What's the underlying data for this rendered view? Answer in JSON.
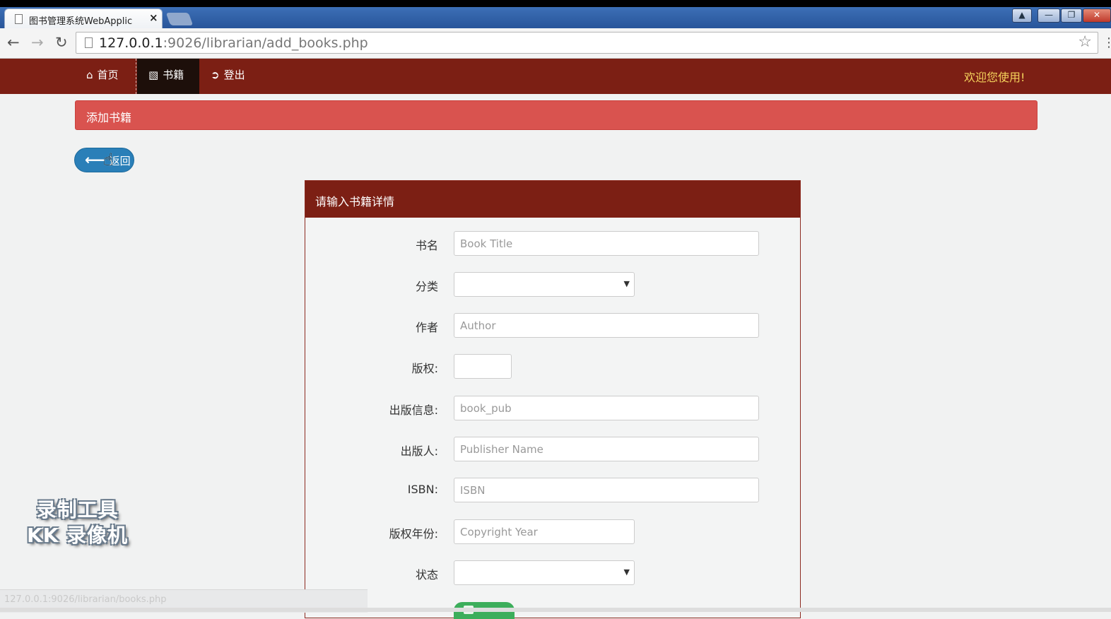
{
  "browser": {
    "tab_title": "图书管理系统WebApplic",
    "tab_close": "×",
    "url_host": "127.0.0.1",
    "url_rest": ":9026/librarian/add_books.php",
    "status_url": "127.0.0.1:9026/librarian/books.php"
  },
  "navbar": {
    "items": [
      {
        "label": "首页",
        "icon": "home-icon",
        "active": false
      },
      {
        "label": "书籍",
        "icon": "book-icon",
        "active": true
      },
      {
        "label": "登出",
        "icon": "sign-out-icon",
        "active": false
      }
    ],
    "welcome": "欢迎您使用!"
  },
  "page": {
    "header": "添加书籍",
    "back_label": "返回"
  },
  "form": {
    "heading": "请输入书籍详情",
    "fields": [
      {
        "label": "书名",
        "type": "text",
        "placeholder": "Book Title"
      },
      {
        "label": "分类",
        "type": "select",
        "value": ""
      },
      {
        "label": "作者",
        "type": "text",
        "placeholder": "Author"
      },
      {
        "label": "版权:",
        "type": "text",
        "placeholder": ""
      },
      {
        "label": "出版信息:",
        "type": "text",
        "placeholder": "book_pub"
      },
      {
        "label": "出版人:",
        "type": "text",
        "placeholder": "Publisher Name"
      },
      {
        "label": "ISBN:",
        "type": "text",
        "placeholder": "ISBN"
      },
      {
        "label": "版权年份:",
        "type": "text",
        "placeholder": "Copyright Year"
      },
      {
        "label": "状态",
        "type": "select",
        "value": ""
      }
    ]
  },
  "watermark": {
    "line1": "录制工具",
    "line2": "KK 录像机"
  },
  "colors": {
    "navbar": "#7c1f14",
    "header": "#d9534f",
    "back_button": "#2a7fb8",
    "welcome_text": "#f5d35c"
  }
}
